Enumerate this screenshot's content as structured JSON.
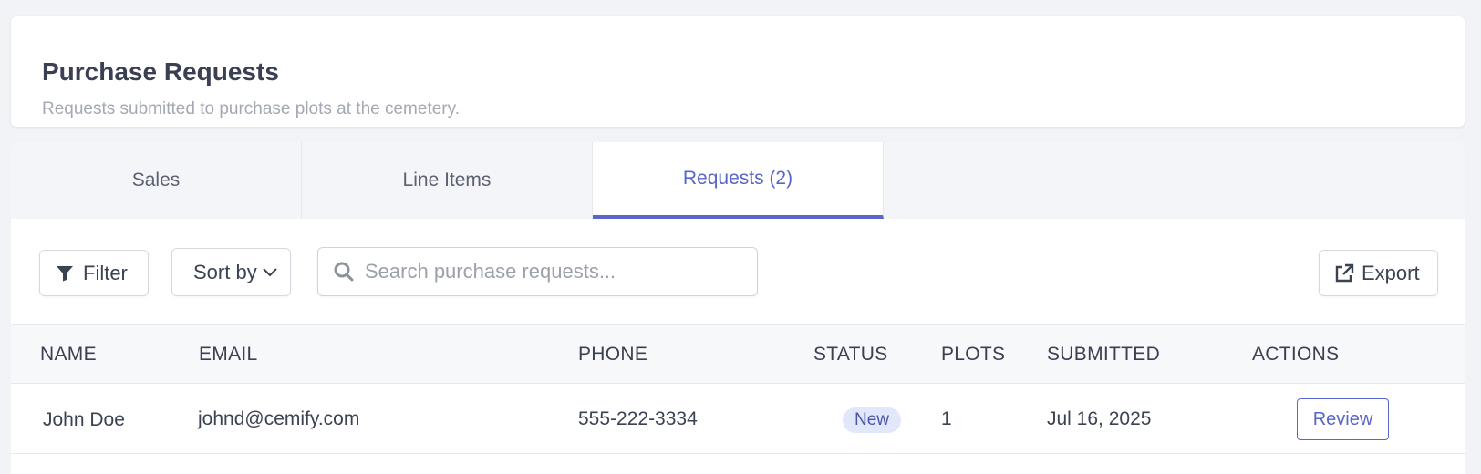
{
  "header": {
    "title": "Purchase Requests",
    "subtitle": "Requests submitted to purchase plots at the cemetery."
  },
  "tabs": [
    {
      "label": "Sales",
      "active": false
    },
    {
      "label": "Line Items",
      "active": false
    },
    {
      "label": "Requests (2)",
      "active": true
    }
  ],
  "toolbar": {
    "filter_label": "Filter",
    "sort_label": "Sort by",
    "search_placeholder": "Search purchase requests...",
    "export_label": "Export"
  },
  "table": {
    "columns": [
      "NAME",
      "EMAIL",
      "PHONE",
      "STATUS",
      "PLOTS",
      "SUBMITTED",
      "ACTIONS"
    ],
    "rows": [
      {
        "name": "John Doe",
        "email": "johnd@cemify.com",
        "phone": "555-222-3334",
        "status": "New",
        "plots": "1",
        "submitted": "Jul 16, 2025",
        "action": "Review"
      }
    ]
  },
  "colors": {
    "accent": "#5a66cf",
    "badge_bg": "#e1e8fb"
  },
  "icons": {
    "filter": "filter-icon",
    "sort": "chevron-down-icon",
    "search": "search-icon",
    "export": "external-link-icon"
  }
}
